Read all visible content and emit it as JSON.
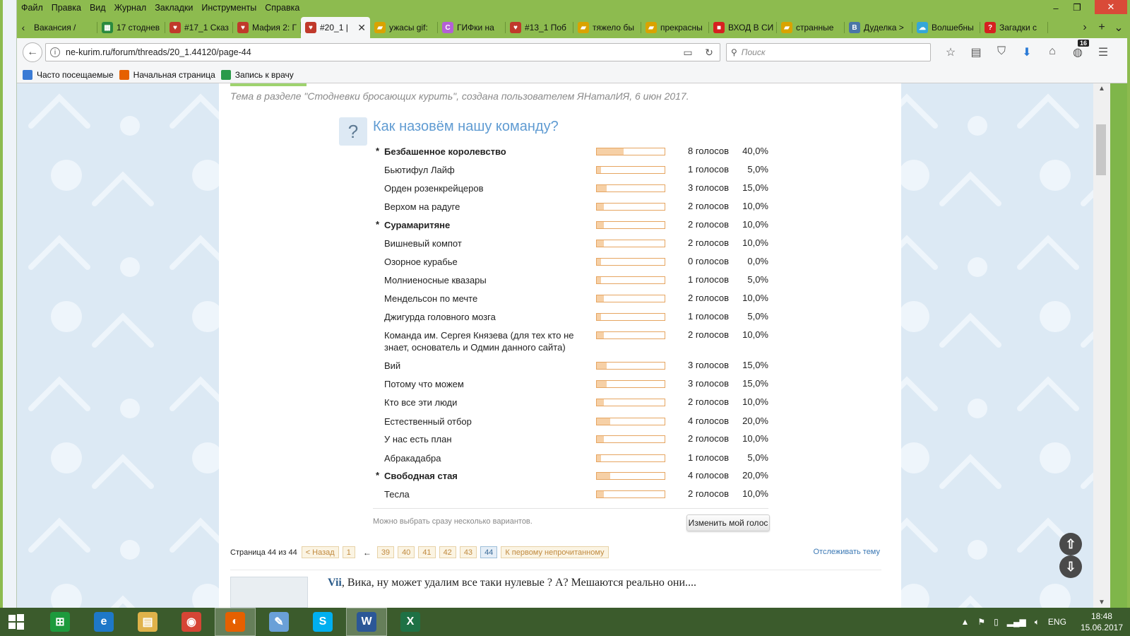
{
  "menu": [
    "Файл",
    "Правка",
    "Вид",
    "Журнал",
    "Закладки",
    "Инструменты",
    "Справка"
  ],
  "tabs": [
    {
      "label": "Вакансия /",
      "icon": "chevron-left-icon",
      "color": "#8dbb4f"
    },
    {
      "label": "17 стоднев",
      "icon": "spreadsheet-icon",
      "color": "#2a8a3e"
    },
    {
      "label": "#17_1 Сказ",
      "icon": "heart-stop-icon",
      "color": "#c0392b"
    },
    {
      "label": "Мафия 2: Г",
      "icon": "heart-stop-icon",
      "color": "#c0392b"
    },
    {
      "label": "#20_1 |",
      "icon": "heart-stop-icon",
      "color": "#c0392b",
      "active": true
    },
    {
      "label": "ужасы gif:",
      "icon": "folder-icon",
      "color": "#d9a300"
    },
    {
      "label": "ГИФки на",
      "icon": "c-icon",
      "color": "#b45fd6"
    },
    {
      "label": "#13_1 Поб",
      "icon": "heart-stop-icon",
      "color": "#c0392b"
    },
    {
      "label": "тяжело бы",
      "icon": "folder-icon",
      "color": "#d9a300"
    },
    {
      "label": "прекрасны",
      "icon": "folder-icon",
      "color": "#d9a300"
    },
    {
      "label": "ВХОД В СИ",
      "icon": "red-square-icon",
      "color": "#d62020"
    },
    {
      "label": "странные",
      "icon": "folder-icon",
      "color": "#d9a300"
    },
    {
      "label": "Дуделка >",
      "icon": "vk-icon",
      "color": "#4a76a8"
    },
    {
      "label": "Волшебны",
      "icon": "cloud-icon",
      "color": "#35a7d8"
    },
    {
      "label": "Загадки с",
      "icon": "question-icon",
      "color": "#d62020"
    }
  ],
  "nav": {
    "url": "ne-kurim.ru/forum/threads/20_1.44120/page-44",
    "search_placeholder": "Поиск",
    "downloads_badge": "16"
  },
  "bookmarks": [
    {
      "label": "Часто посещаемые",
      "color": "#3a7bd5"
    },
    {
      "label": "Начальная страница",
      "color": "#e66000"
    },
    {
      "label": "Запись к врачу",
      "color": "#2a9a4a"
    }
  ],
  "thread_info": "Тема в разделе \"Стодневки бросающих курить\", создана пользователем ЯНаталИЯ, 6 июн 2017.",
  "poll": {
    "question_mark": "?",
    "title": "Как назовём нашу команду?",
    "options": [
      {
        "star": "*",
        "label": "Безбашенное королевство",
        "votes": "8 голосов",
        "pct": "40,0%",
        "fraction": 0.4,
        "bold": true
      },
      {
        "star": "",
        "label": "Бьютифул Лайф",
        "votes": "1 голосов",
        "pct": "5,0%",
        "fraction": 0.05,
        "bold": false
      },
      {
        "star": "",
        "label": "Орден розенкрейцеров",
        "votes": "3 голосов",
        "pct": "15,0%",
        "fraction": 0.15,
        "bold": false
      },
      {
        "star": "",
        "label": "Верхом на радуге",
        "votes": "2 голосов",
        "pct": "10,0%",
        "fraction": 0.1,
        "bold": false
      },
      {
        "star": "*",
        "label": "Сурамаритяне",
        "votes": "2 голосов",
        "pct": "10,0%",
        "fraction": 0.1,
        "bold": true
      },
      {
        "star": "",
        "label": "Вишневый компот",
        "votes": "2 голосов",
        "pct": "10,0%",
        "fraction": 0.1,
        "bold": false
      },
      {
        "star": "",
        "label": "Озорное курабье",
        "votes": "0 голосов",
        "pct": "0,0%",
        "fraction": 0.0,
        "bold": false
      },
      {
        "star": "",
        "label": "Молниеносные квазары",
        "votes": "1 голосов",
        "pct": "5,0%",
        "fraction": 0.05,
        "bold": false
      },
      {
        "star": "",
        "label": "Мендельсон по мечте",
        "votes": "2 голосов",
        "pct": "10,0%",
        "fraction": 0.1,
        "bold": false
      },
      {
        "star": "",
        "label": "Джигурда головного мозга",
        "votes": "1 голосов",
        "pct": "5,0%",
        "fraction": 0.05,
        "bold": false
      },
      {
        "star": "",
        "label": "Команда им. Сергея Князева (для тех кто не знает, основатель и Одмин данного сайта)",
        "votes": "2 голосов",
        "pct": "10,0%",
        "fraction": 0.1,
        "bold": false
      },
      {
        "star": "",
        "label": "Вий",
        "votes": "3 голосов",
        "pct": "15,0%",
        "fraction": 0.15,
        "bold": false
      },
      {
        "star": "",
        "label": "Потому что можем",
        "votes": "3 голосов",
        "pct": "15,0%",
        "fraction": 0.15,
        "bold": false
      },
      {
        "star": "",
        "label": "Кто все эти люди",
        "votes": "2 голосов",
        "pct": "10,0%",
        "fraction": 0.1,
        "bold": false
      },
      {
        "star": "",
        "label": "Естественный отбор",
        "votes": "4 голосов",
        "pct": "20,0%",
        "fraction": 0.2,
        "bold": false
      },
      {
        "star": "",
        "label": "У нас есть план",
        "votes": "2 голосов",
        "pct": "10,0%",
        "fraction": 0.1,
        "bold": false
      },
      {
        "star": "",
        "label": "Абракадабра",
        "votes": "1 голосов",
        "pct": "5,0%",
        "fraction": 0.05,
        "bold": false
      },
      {
        "star": "*",
        "label": "Свободная стая",
        "votes": "4 голосов",
        "pct": "20,0%",
        "fraction": 0.2,
        "bold": true
      },
      {
        "star": "",
        "label": "Тесла",
        "votes": "2 голосов",
        "pct": "10,0%",
        "fraction": 0.1,
        "bold": false
      }
    ],
    "note": "Можно выбрать сразу несколько вариантов.",
    "change_vote_label": "Изменить мой голос"
  },
  "pagination": {
    "label": "Страница 44 из 44",
    "prev": "< Назад",
    "first": "1",
    "ellipsis": "←",
    "pages": [
      "39",
      "40",
      "41",
      "42",
      "43",
      "44"
    ],
    "current": "44",
    "unread": "К первому непрочитанному",
    "watch": "Отслеживать тему"
  },
  "post": {
    "author": "Vii",
    "text": ", Вика, ну может удалим все таки нулевые ? А? Мешаются реально они...."
  },
  "taskbar": {
    "apps": [
      {
        "name": "store-icon",
        "color": "#1d9a3d",
        "glyph": "⊞"
      },
      {
        "name": "ie-icon",
        "color": "#1e78c8",
        "glyph": "e"
      },
      {
        "name": "explorer-icon",
        "color": "#e0b24a",
        "glyph": "▤"
      },
      {
        "name": "chrome-icon",
        "color": "#d64535",
        "glyph": "◉"
      },
      {
        "name": "firefox-icon",
        "color": "#e66000",
        "glyph": "◐",
        "active": true
      },
      {
        "name": "paint-icon",
        "color": "#6aa0d8",
        "glyph": "✎"
      },
      {
        "name": "skype-icon",
        "color": "#00aff0",
        "glyph": "S"
      },
      {
        "name": "word-icon",
        "color": "#2b5797",
        "glyph": "W",
        "active": true
      },
      {
        "name": "excel-icon",
        "color": "#1e7145",
        "glyph": "X"
      }
    ],
    "lang": "ENG",
    "time": "18:48",
    "date": "15.06.2017"
  }
}
